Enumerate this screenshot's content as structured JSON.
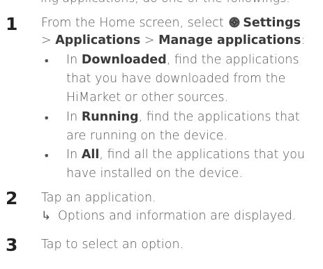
{
  "clipped_header": "ing applications, do one of the followings:",
  "steps": [
    {
      "number": "1",
      "line1_prefix": "From the Home screen, select ",
      "settings_label": "Settings",
      "line2_sep1": "> ",
      "applications_label": "Applications",
      "line2_sep2": " > ",
      "manage_label": "Manage applications",
      "line2_suffix": ":",
      "bullets": [
        {
          "marker": "•",
          "prefix": "In ",
          "keyword": "Downloaded",
          "rest1": ", find the applications",
          "line2": "that you have downloaded from the",
          "line3": "HiMarket or other sources."
        },
        {
          "marker": "•",
          "prefix": "In ",
          "keyword": "Running",
          "rest1": ", find the applications that",
          "line2": "are running on the device."
        },
        {
          "marker": "•",
          "prefix": "In ",
          "keyword": "All",
          "rest1": ", find all the applications that you",
          "line2": "have installed on the device."
        }
      ]
    },
    {
      "number": "2",
      "text": "Tap an application.",
      "result_arrow": "↳",
      "result_text": "Options and information are displayed."
    },
    {
      "number": "3",
      "text": "Tap to select an option."
    }
  ],
  "icons": {
    "settings": "settings-gear-icon"
  },
  "colors": {
    "body_text": "#555555",
    "emphasis_text": "#3a3a3a",
    "step_number": "#222222"
  }
}
